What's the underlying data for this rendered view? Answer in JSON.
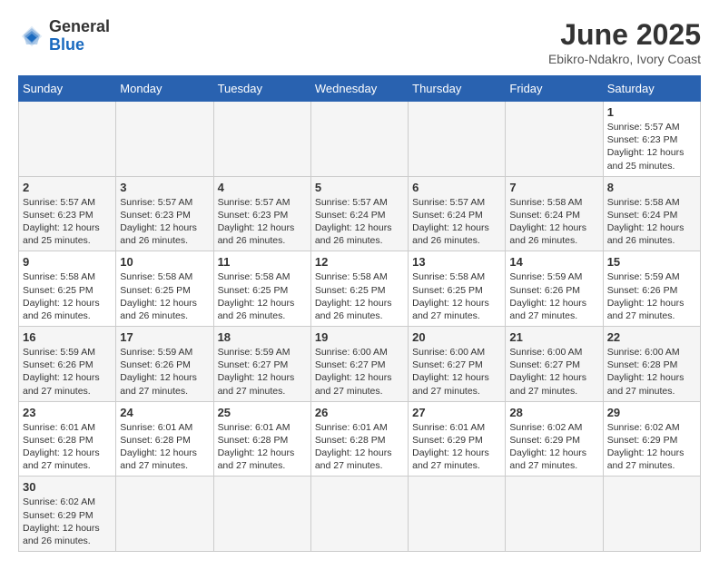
{
  "header": {
    "logo_general": "General",
    "logo_blue": "Blue",
    "month_title": "June 2025",
    "location": "Ebikro-Ndakro, Ivory Coast"
  },
  "weekdays": [
    "Sunday",
    "Monday",
    "Tuesday",
    "Wednesday",
    "Thursday",
    "Friday",
    "Saturday"
  ],
  "days": [
    null,
    null,
    null,
    null,
    null,
    null,
    {
      "num": "1",
      "sunrise": "5:57 AM",
      "sunset": "6:23 PM",
      "daylight": "12 hours and 25 minutes."
    },
    {
      "num": "2",
      "sunrise": "5:57 AM",
      "sunset": "6:23 PM",
      "daylight": "12 hours and 25 minutes."
    },
    {
      "num": "3",
      "sunrise": "5:57 AM",
      "sunset": "6:23 PM",
      "daylight": "12 hours and 26 minutes."
    },
    {
      "num": "4",
      "sunrise": "5:57 AM",
      "sunset": "6:23 PM",
      "daylight": "12 hours and 26 minutes."
    },
    {
      "num": "5",
      "sunrise": "5:57 AM",
      "sunset": "6:24 PM",
      "daylight": "12 hours and 26 minutes."
    },
    {
      "num": "6",
      "sunrise": "5:57 AM",
      "sunset": "6:24 PM",
      "daylight": "12 hours and 26 minutes."
    },
    {
      "num": "7",
      "sunrise": "5:58 AM",
      "sunset": "6:24 PM",
      "daylight": "12 hours and 26 minutes."
    },
    {
      "num": "8",
      "sunrise": "5:58 AM",
      "sunset": "6:24 PM",
      "daylight": "12 hours and 26 minutes."
    },
    {
      "num": "9",
      "sunrise": "5:58 AM",
      "sunset": "6:25 PM",
      "daylight": "12 hours and 26 minutes."
    },
    {
      "num": "10",
      "sunrise": "5:58 AM",
      "sunset": "6:25 PM",
      "daylight": "12 hours and 26 minutes."
    },
    {
      "num": "11",
      "sunrise": "5:58 AM",
      "sunset": "6:25 PM",
      "daylight": "12 hours and 26 minutes."
    },
    {
      "num": "12",
      "sunrise": "5:58 AM",
      "sunset": "6:25 PM",
      "daylight": "12 hours and 26 minutes."
    },
    {
      "num": "13",
      "sunrise": "5:58 AM",
      "sunset": "6:25 PM",
      "daylight": "12 hours and 27 minutes."
    },
    {
      "num": "14",
      "sunrise": "5:59 AM",
      "sunset": "6:26 PM",
      "daylight": "12 hours and 27 minutes."
    },
    {
      "num": "15",
      "sunrise": "5:59 AM",
      "sunset": "6:26 PM",
      "daylight": "12 hours and 27 minutes."
    },
    {
      "num": "16",
      "sunrise": "5:59 AM",
      "sunset": "6:26 PM",
      "daylight": "12 hours and 27 minutes."
    },
    {
      "num": "17",
      "sunrise": "5:59 AM",
      "sunset": "6:26 PM",
      "daylight": "12 hours and 27 minutes."
    },
    {
      "num": "18",
      "sunrise": "5:59 AM",
      "sunset": "6:27 PM",
      "daylight": "12 hours and 27 minutes."
    },
    {
      "num": "19",
      "sunrise": "6:00 AM",
      "sunset": "6:27 PM",
      "daylight": "12 hours and 27 minutes."
    },
    {
      "num": "20",
      "sunrise": "6:00 AM",
      "sunset": "6:27 PM",
      "daylight": "12 hours and 27 minutes."
    },
    {
      "num": "21",
      "sunrise": "6:00 AM",
      "sunset": "6:27 PM",
      "daylight": "12 hours and 27 minutes."
    },
    {
      "num": "22",
      "sunrise": "6:00 AM",
      "sunset": "6:28 PM",
      "daylight": "12 hours and 27 minutes."
    },
    {
      "num": "23",
      "sunrise": "6:01 AM",
      "sunset": "6:28 PM",
      "daylight": "12 hours and 27 minutes."
    },
    {
      "num": "24",
      "sunrise": "6:01 AM",
      "sunset": "6:28 PM",
      "daylight": "12 hours and 27 minutes."
    },
    {
      "num": "25",
      "sunrise": "6:01 AM",
      "sunset": "6:28 PM",
      "daylight": "12 hours and 27 minutes."
    },
    {
      "num": "26",
      "sunrise": "6:01 AM",
      "sunset": "6:28 PM",
      "daylight": "12 hours and 27 minutes."
    },
    {
      "num": "27",
      "sunrise": "6:01 AM",
      "sunset": "6:29 PM",
      "daylight": "12 hours and 27 minutes."
    },
    {
      "num": "28",
      "sunrise": "6:02 AM",
      "sunset": "6:29 PM",
      "daylight": "12 hours and 27 minutes."
    },
    {
      "num": "29",
      "sunrise": "6:02 AM",
      "sunset": "6:29 PM",
      "daylight": "12 hours and 27 minutes."
    },
    {
      "num": "30",
      "sunrise": "6:02 AM",
      "sunset": "6:29 PM",
      "daylight": "12 hours and 26 minutes."
    },
    null,
    null,
    null,
    null,
    null
  ]
}
